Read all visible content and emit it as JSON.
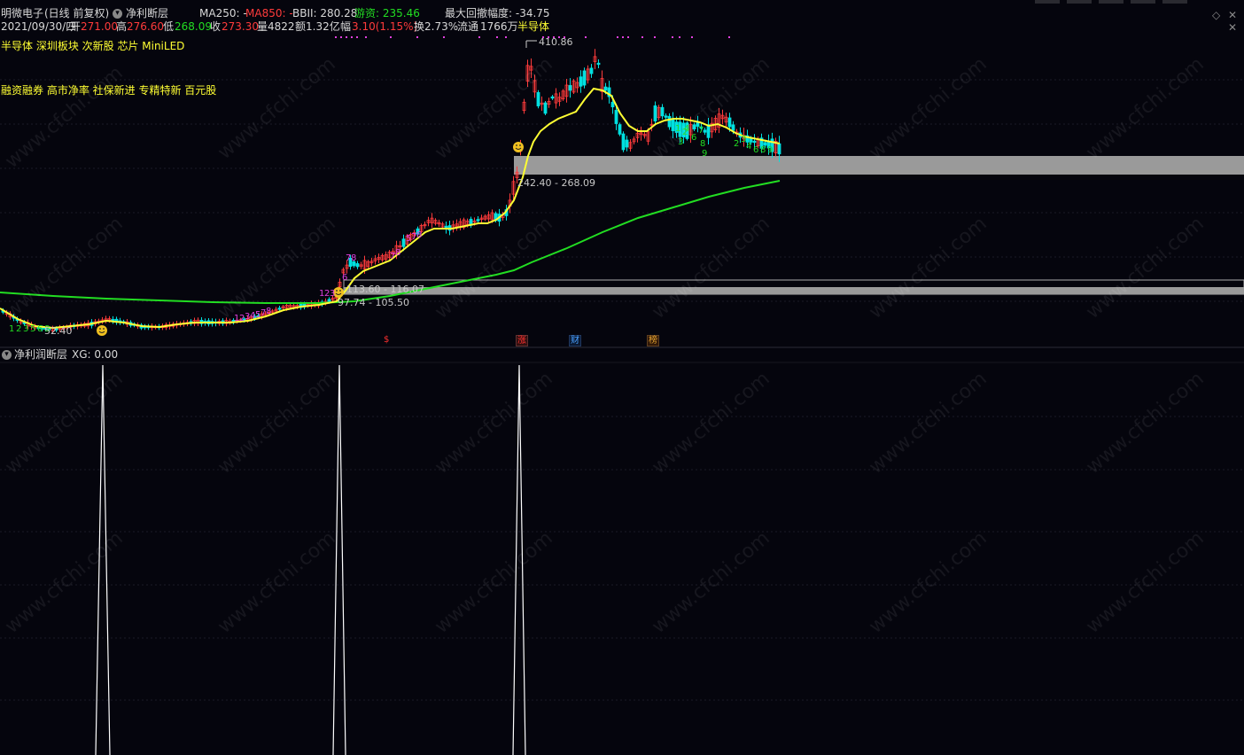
{
  "header": {
    "stock_name": "明微电子",
    "period_label": "(日线 前复权)",
    "indicator_name": "净利断层",
    "ma250_label": "MA250: -",
    "ma850_label": "MA850: -",
    "bbii_label": "BBII: 280.28",
    "youzi_label": "游资: 235.46",
    "max_drawdown_label": "最大回撤幅度: -34.75"
  },
  "quote": {
    "date": "2021/09/30/四",
    "open_label": "开",
    "open_value": "271.00",
    "high_label": "高",
    "high_value": "276.60",
    "low_label": "低",
    "low_value": "268.09",
    "close_label": "收",
    "close_value": "273.30",
    "volume_label": "量",
    "volume_value": "4822",
    "amount_label": "额",
    "amount_value": "1.32亿",
    "change_label": "幅",
    "change_value": "3.10(1.15%)",
    "turnover_label": "换",
    "turnover_value": "2.73%",
    "float_label": "流通",
    "float_value": "1766万",
    "sector": "半导体"
  },
  "concepts": {
    "line1": "半导体 深圳板块 次新股 芯片 MiniLED",
    "line2": "融资融券 高市净率 社保新进 专精特新 百元股"
  },
  "price_annotations": {
    "peak": "410.86",
    "gap_high": "242.40 - 268.09",
    "gap_mid": "113.60 - 116.07",
    "gap_low": "97.74 - 105.50",
    "low": "52.40"
  },
  "event_tags": [
    {
      "text": "$",
      "color": "#ff3030"
    },
    {
      "text": "涨",
      "color": "#ff3030"
    },
    {
      "text": "财",
      "color": "#4aa0ff"
    },
    {
      "text": "榜",
      "color": "#e0a030"
    }
  ],
  "sub_panel": {
    "title": "净利润断层",
    "xg_label": "XG: 0.00"
  },
  "watermark": "www.cfchi.com",
  "colors": {
    "up": "#ff3b3b",
    "down": "#00e0e0",
    "ma_yellow": "#ffff33",
    "ma_green": "#22dd22",
    "gap_band": "#9a9a9a",
    "magenta": "#e040e0"
  }
}
